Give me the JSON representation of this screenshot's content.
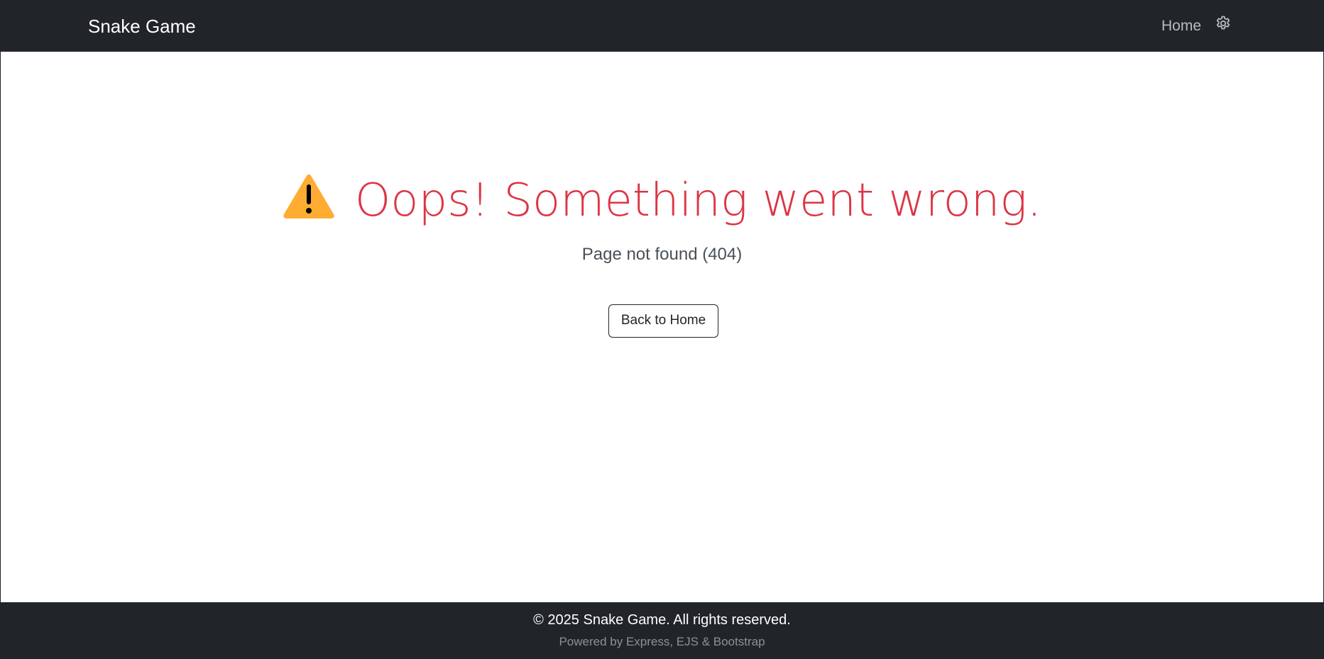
{
  "navbar": {
    "brand": "Snake Game",
    "home_link": "Home",
    "settings_icon": "gear-icon"
  },
  "error": {
    "icon": "warning-icon",
    "title": "Oops! Something went wrong.",
    "message": "Page not found (404)",
    "back_button": "Back to Home"
  },
  "footer": {
    "copyright": "© 2025 Snake Game. All rights reserved.",
    "powered_by": "Powered by Express, EJS & Bootstrap"
  },
  "colors": {
    "navbar_bg": "#212529",
    "error_red": "#dc3545",
    "warning_yellow": "#ffac33"
  }
}
